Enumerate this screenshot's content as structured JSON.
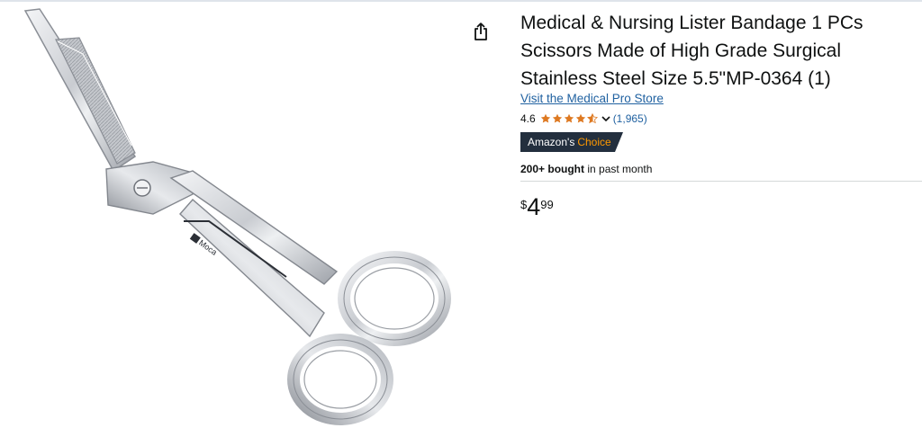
{
  "product": {
    "title": "Medical & Nursing Lister Bandage 1 PCs Scissors Made of High Grade Surgical Stainless Steel Size 5.5\"MP-0364 (1)",
    "store_link": "Visit the Medical Pro Store",
    "rating": {
      "value": "4.6",
      "stars_out_of_5": 4.6,
      "count": "(1,965)"
    },
    "badge": {
      "part1": "Amazon's",
      "part2": "Choice"
    },
    "bought": {
      "bold": "200+ bought",
      "rest": "in past month"
    },
    "price": {
      "symbol": "$",
      "whole": "4",
      "fraction": "99"
    }
  },
  "image": {
    "brand_mark": "Moca",
    "icon": "lister-bandage-scissors-image"
  },
  "icons": {
    "share": "share-icon",
    "star": "star-icon",
    "chevron": "chevron-down-icon"
  },
  "colors": {
    "link": "#2162a1",
    "star": "#de7921",
    "badge_bg": "#232f3e",
    "badge_accent": "#ff9900",
    "text": "#0f1111"
  }
}
